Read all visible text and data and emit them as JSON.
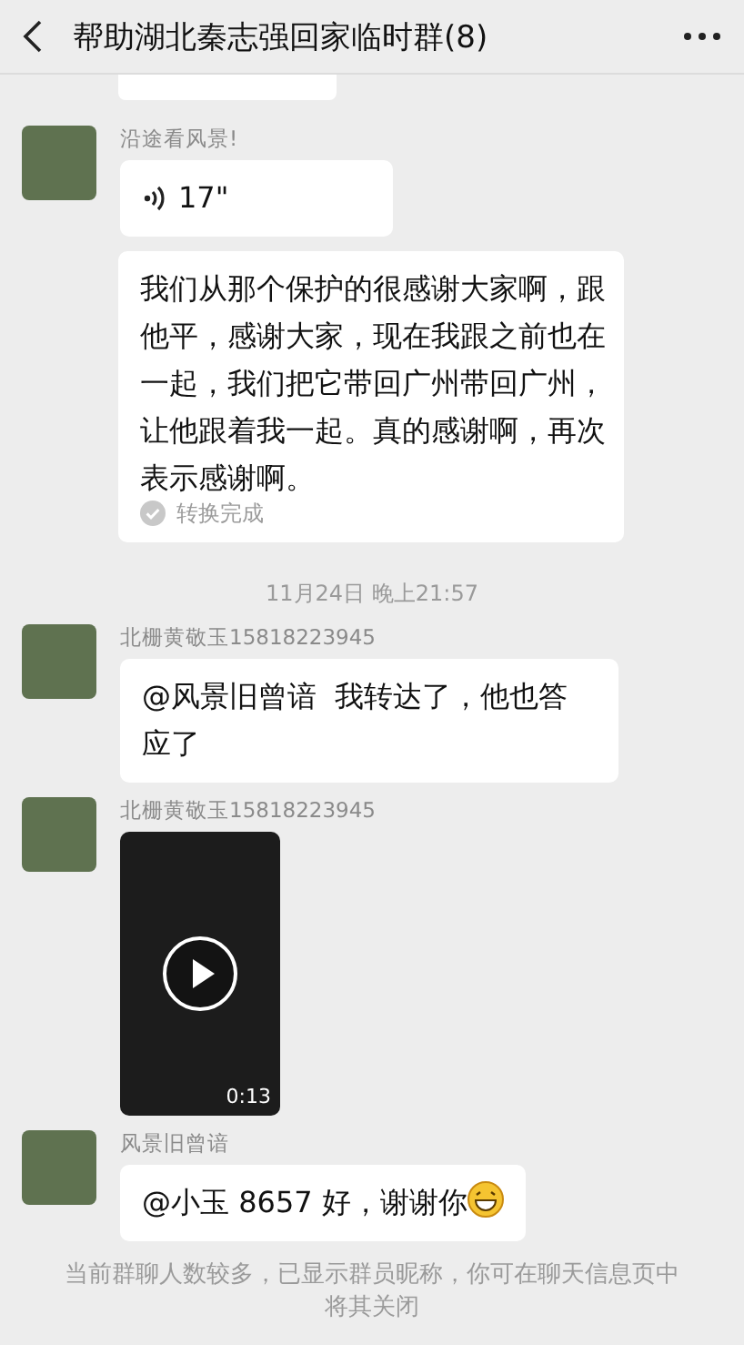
{
  "header": {
    "title": "帮助湖北秦志强回家临时群(8)"
  },
  "messages": [
    {
      "kind": "partial"
    },
    {
      "kind": "voice",
      "sender": "沿途看风景!",
      "duration": "17\""
    },
    {
      "kind": "transcript",
      "text": "我们从那个保护的很感谢大家啊，跟他平，感谢大家，现在我跟之前也在一起，我们把它带回广州带回广州，让他跟着我一起。真的感谢啊，再次表示感谢啊。",
      "status": "转换完成"
    },
    {
      "kind": "time",
      "text": "11月24日 晚上21:57"
    },
    {
      "kind": "text",
      "sender": "北栅黄敬玉15818223945",
      "text": "@风景旧曾谙  我转达了，他也答应了",
      "grin": false
    },
    {
      "kind": "video",
      "sender": "北栅黄敬玉15818223945",
      "duration": "0:13"
    },
    {
      "kind": "text",
      "sender": "风景旧曾谙",
      "text": "@小玉 8657 好，谢谢你",
      "grin": true
    }
  ],
  "notice": "当前群聊人数较多，已显示群员昵称，你可在聊天信息页中将其关闭"
}
